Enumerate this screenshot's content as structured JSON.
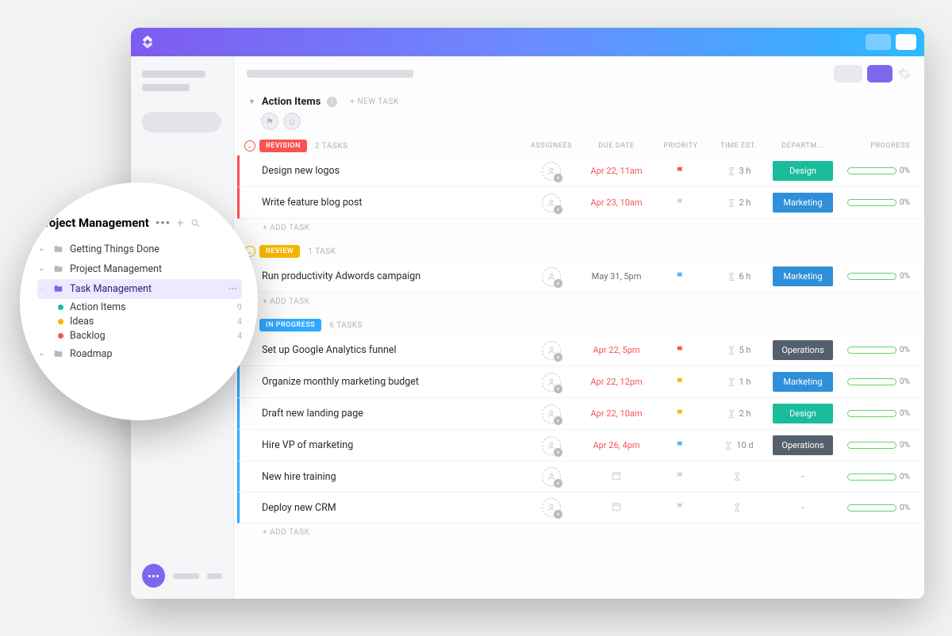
{
  "section": {
    "title": "Action Items",
    "new_task_label": "+ NEW TASK"
  },
  "columns": {
    "assignees": "ASSIGNEES",
    "due": "DUE DATE",
    "priority": "PRIORITY",
    "time_est": "TIME EST.",
    "dept": "DEPARTM...",
    "progress": "PROGRESS"
  },
  "add_task_label": "+ ADD TASK",
  "dept_colors": {
    "Design": "#1abc9c",
    "Marketing": "#2f90d9",
    "Operations": "#55606d"
  },
  "groups": [
    {
      "id": "revision",
      "label": "REVISION",
      "color": "#fa5252",
      "count_label": "2 TASKS",
      "tasks": [
        {
          "name": "Design new logos",
          "due": "Apr 22, 11am",
          "due_color": "red",
          "flag": "red",
          "time": "3 h",
          "dept": "Design",
          "progress": "0%"
        },
        {
          "name": "Write feature blog post",
          "due": "Apr 23, 10am",
          "due_color": "red",
          "flag": "grey",
          "time": "2 h",
          "dept": "Marketing",
          "progress": "0%"
        }
      ]
    },
    {
      "id": "review",
      "label": "REVIEW",
      "color": "#f7b500",
      "count_label": "1 TASK",
      "tasks": [
        {
          "name": "Run productivity Adwords campaign",
          "due": "May 31, 5pm",
          "due_color": "grey",
          "flag": "blue",
          "time": "6 h",
          "dept": "Marketing",
          "progress": "0%"
        }
      ]
    },
    {
      "id": "inprogress",
      "label": "IN PROGRESS",
      "color": "#2ea9ff",
      "count_label": "6 TASKS",
      "tasks": [
        {
          "name": "Set up Google Analytics funnel",
          "due": "Apr 22, 5pm",
          "due_color": "red",
          "flag": "red",
          "time": "5 h",
          "dept": "Operations",
          "progress": "0%"
        },
        {
          "name": "Organize monthly marketing budget",
          "due": "Apr 22, 12pm",
          "due_color": "red",
          "flag": "yellow",
          "time": "1 h",
          "dept": "Marketing",
          "progress": "0%"
        },
        {
          "name": "Draft new landing page",
          "due": "Apr 22, 10am",
          "due_color": "red",
          "flag": "yellow",
          "time": "2 h",
          "dept": "Design",
          "progress": "0%"
        },
        {
          "name": "Hire VP of marketing",
          "due": "Apr 26, 4pm",
          "due_color": "red",
          "flag": "blue",
          "time": "10 d",
          "dept": "Operations",
          "progress": "0%"
        },
        {
          "name": "New hire training",
          "due": "",
          "due_color": "none",
          "flag": "grey",
          "time": "",
          "dept": "-",
          "progress": "0%"
        },
        {
          "name": "Deploy new CRM",
          "due": "",
          "due_color": "none",
          "flag": "grey",
          "time": "",
          "dept": "-",
          "progress": "0%"
        }
      ]
    }
  ],
  "magnifier": {
    "title": "Project Management",
    "items": [
      {
        "type": "folder",
        "label": "Getting Things Done"
      },
      {
        "type": "folder",
        "label": "Project Management"
      },
      {
        "type": "folder",
        "label": "Task Management",
        "active": true,
        "more": true
      },
      {
        "type": "list",
        "label": "Action Items",
        "dot": "#1abc9c",
        "count": "9"
      },
      {
        "type": "list",
        "label": "Ideas",
        "dot": "#f7b500",
        "count": "4"
      },
      {
        "type": "list",
        "label": "Backlog",
        "dot": "#fa5252",
        "count": "4"
      },
      {
        "type": "folder",
        "label": "Roadmap"
      }
    ]
  },
  "flag_colors": {
    "red": "#fa5252",
    "yellow": "#f7b500",
    "blue": "#4fb7ff",
    "grey": "#d2d3dc"
  }
}
